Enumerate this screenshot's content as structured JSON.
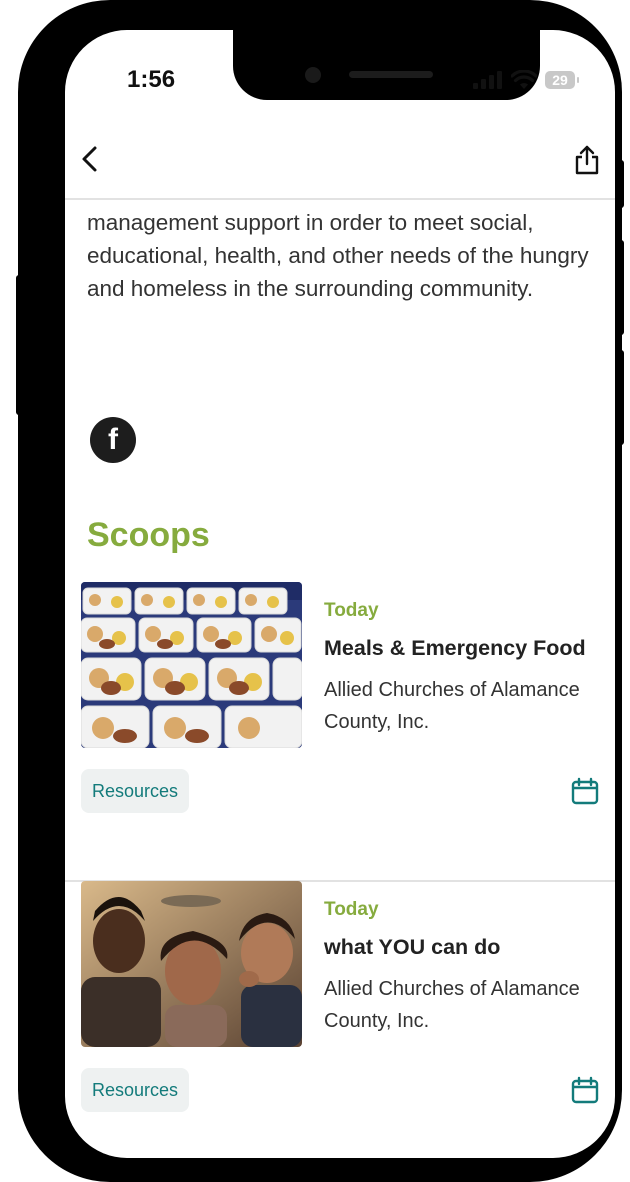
{
  "status": {
    "time": "1:56",
    "battery": "29"
  },
  "nav": {
    "back_icon": "chevron-left-icon",
    "share_icon": "share-icon"
  },
  "description": "management support in order to meet social, educational, health, and other needs of the hungry and homeless in the surrounding community.",
  "social": {
    "facebook_glyph": "f"
  },
  "section_title": "Scoops",
  "scoops": [
    {
      "when": "Today",
      "title": "Meals & Emergency Food",
      "org": "Allied Churches of Alamance County, Inc.",
      "tag": "Resources",
      "image": "trays-of-meals-photo"
    },
    {
      "when": "Today",
      "title": "what YOU can do",
      "org": "Allied Churches of Alamance County, Inc.",
      "tag": "Resources",
      "image": "family-in-car-photo"
    }
  ],
  "colors": {
    "accent_green": "#86ab3e",
    "teal": "#137b7b",
    "divider": "#e2e2e2"
  }
}
